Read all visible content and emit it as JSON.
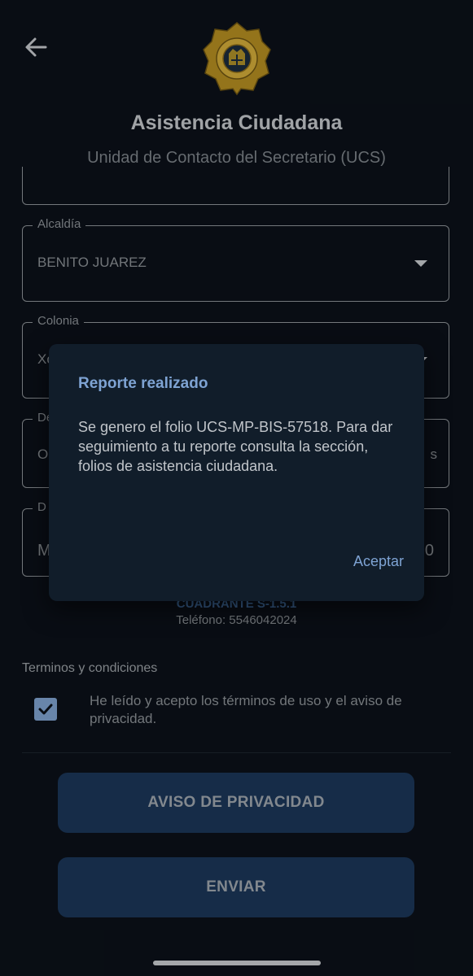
{
  "header": {
    "title": "Asistencia Ciudadana",
    "subtitle": "Unidad de Contacto del Secretario (UCS)"
  },
  "form": {
    "alcaldia": {
      "label": "Alcaldía",
      "value": "BENITO JUAREZ"
    },
    "colonia": {
      "label": "Colonia",
      "value": "Xo"
    },
    "field3": {
      "label": "De",
      "value_left": "O",
      "value_right": "s"
    },
    "field4": {
      "label": "D",
      "value_left": "M",
      "value_right": "0"
    }
  },
  "cuadrante": {
    "name": "CUADRANTE S-1.5.1",
    "phone": "Teléfono: 5546042024"
  },
  "terms": {
    "title": "Terminos y condiciones",
    "text": "He leído y acepto los términos de uso y el aviso de privacidad.",
    "checked": true
  },
  "buttons": {
    "privacy": "AVISO DE PRIVACIDAD",
    "send": "ENVIAR"
  },
  "dialog": {
    "title": "Reporte realizado",
    "body": "Se genero el folio UCS-MP-BIS-57518. Para dar seguimiento a tu reporte consulta la sección, folios de asistencia ciudadana.",
    "action": "Aceptar"
  },
  "colors": {
    "background": "#0b1119",
    "accent": "#7ea3d3",
    "button_bg": "#1c3658",
    "dialog_bg": "#111d2a",
    "badge_gold": "#c9a227"
  },
  "icons": {
    "back": "arrow-left-icon",
    "logo": "police-badge-logo",
    "dropdown": "caret-down-icon",
    "check": "checkmark-icon"
  }
}
